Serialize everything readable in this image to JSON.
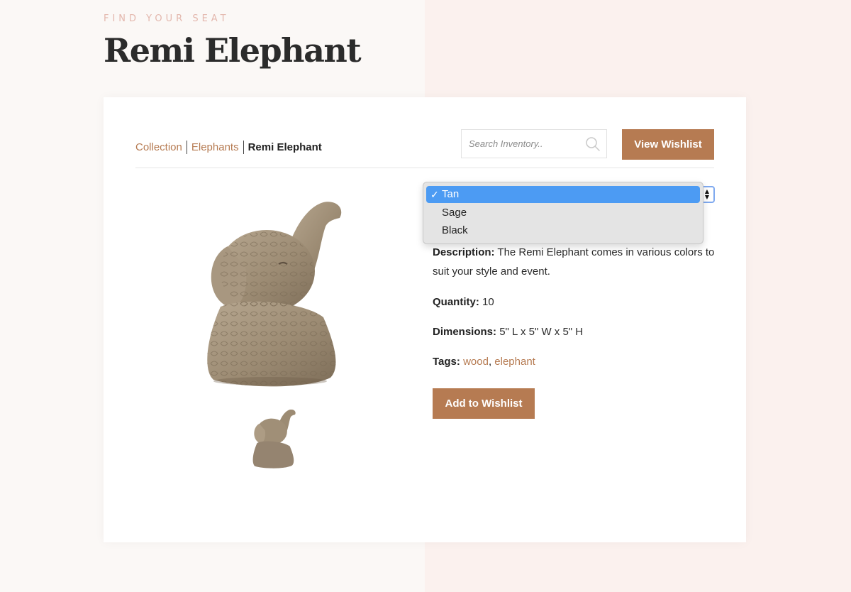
{
  "header": {
    "eyebrow": "FIND YOUR SEAT",
    "title": "Remi Elephant"
  },
  "breadcrumb": {
    "items": [
      {
        "label": "Collection"
      },
      {
        "label": "Elephants"
      }
    ],
    "current": "Remi Elephant"
  },
  "search": {
    "placeholder": "Search Inventory..",
    "value": ""
  },
  "toolbar": {
    "view_wishlist_label": "View Wishlist"
  },
  "color_select": {
    "selected": "Tan",
    "check_glyph": "✓",
    "arrows_glyph_up": "▲",
    "arrows_glyph_down": "▼",
    "options": [
      {
        "label": "Tan"
      },
      {
        "label": "Sage"
      },
      {
        "label": "Black"
      }
    ]
  },
  "details": {
    "description_label": "Description:",
    "description_text": "The Remi Elephant comes in various colors to suit your style and event.",
    "quantity_label": "Quantity:",
    "quantity_value": "10",
    "dimensions_label": "Dimensions:",
    "dimensions_value": "5\" L x 5\" W x 5\" H",
    "tags_label": "Tags:",
    "tags": [
      "wood",
      "elephant"
    ],
    "tag_separator": ","
  },
  "actions": {
    "add_to_wishlist_label": "Add to Wishlist"
  },
  "colors": {
    "accent": "#b67b52",
    "eyebrow": "#e3b7ad",
    "selected_option": "#4c9bf3",
    "bg_left": "#fbf8f6",
    "bg_right": "#fbf1ee"
  },
  "icons": {
    "search": "search-icon",
    "checkmark": "checkmark-icon",
    "select_arrows": "select-arrows-icon"
  }
}
